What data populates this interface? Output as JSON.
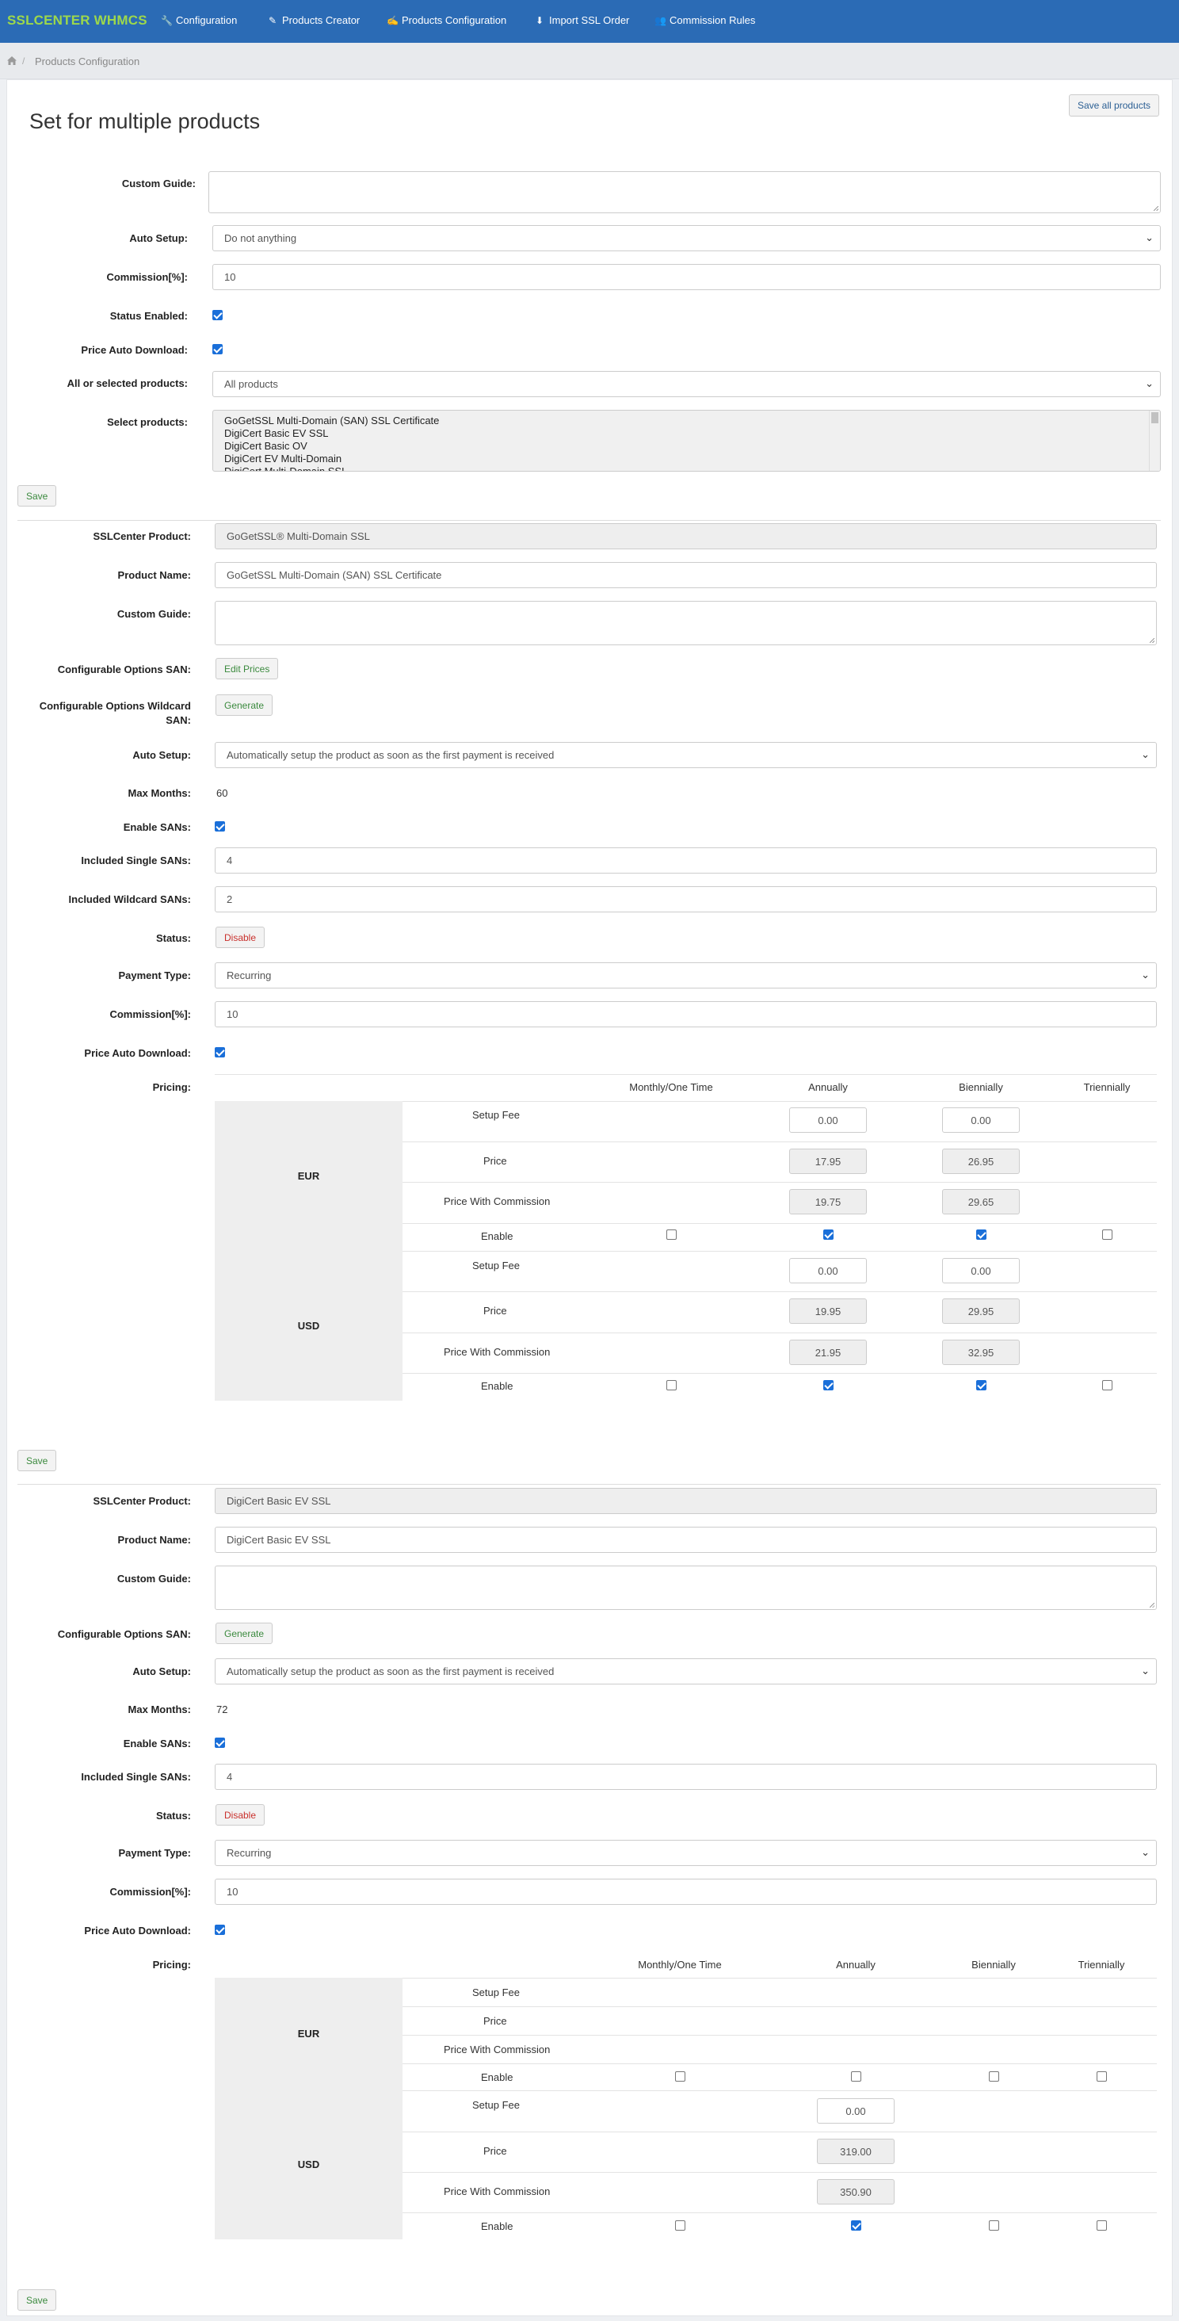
{
  "brand": "SSLCENTER WHMCS",
  "nav": [
    {
      "label": "Configuration",
      "icon": "wrench-icon"
    },
    {
      "label": "Products Creator",
      "icon": "magic-icon"
    },
    {
      "label": "Products Configuration",
      "icon": "edit-icon"
    },
    {
      "label": "Import SSL Order",
      "icon": "download-icon"
    },
    {
      "label": "Commission Rules",
      "icon": "users-icon"
    }
  ],
  "breadcrumb": {
    "current": "Products Configuration"
  },
  "multi": {
    "title": "Set for multiple products",
    "save_all": "Save all products",
    "labels": {
      "custom_guide": "Custom Guide:",
      "auto_setup": "Auto Setup:",
      "commission": "Commission[%]:",
      "status_enabled": "Status Enabled:",
      "price_auto": "Price Auto Download:",
      "all_or_selected": "All or selected products:",
      "select_products": "Select products:"
    },
    "auto_setup_value": "Do not anything",
    "commission_value": "10",
    "status_enabled": true,
    "price_auto": true,
    "all_or_selected_value": "All products",
    "products": [
      "GoGetSSL Multi-Domain (SAN) SSL Certificate",
      "DigiCert Basic EV SSL",
      "DigiCert Basic OV",
      "DigiCert EV Multi-Domain",
      "DigiCert Multi-Domain SSL"
    ],
    "save": "Save"
  },
  "labels": {
    "sslcenter_product": "SSLCenter Product:",
    "product_name": "Product Name:",
    "custom_guide": "Custom Guide:",
    "config_san": "Configurable Options SAN:",
    "config_wildcard_1": "Configurable Options Wildcard",
    "config_wildcard_2": "SAN:",
    "auto_setup": "Auto Setup:",
    "max_months": "Max Months:",
    "enable_sans": "Enable SANs:",
    "included_single": "Included Single SANs:",
    "included_wildcard": "Included Wildcard SANs:",
    "status": "Status:",
    "payment_type": "Payment Type:",
    "commission": "Commission[%]:",
    "price_auto": "Price Auto Download:",
    "pricing": "Pricing:"
  },
  "pricing_headers": [
    "Monthly/One Time",
    "Annually",
    "Biennially",
    "Triennially"
  ],
  "pricing_rows": [
    "Setup Fee",
    "Price",
    "Price With Commission",
    "Enable"
  ],
  "product1": {
    "sslcenter_product": "GoGetSSL® Multi-Domain SSL",
    "product_name": "GoGetSSL Multi-Domain (SAN) SSL Certificate",
    "config_san_button": "Edit Prices",
    "config_wildcard_button": "Generate",
    "auto_setup_value": "Automatically setup the product as soon as the first payment is received",
    "max_months": "60",
    "enable_sans": true,
    "included_single": "4",
    "included_wildcard": "2",
    "status_button": "Disable",
    "payment_type": "Recurring",
    "commission": "10",
    "price_auto": true,
    "eur": {
      "currency": "EUR",
      "setup_fee": [
        "0.00",
        "0.00"
      ],
      "price": [
        "17.95",
        "26.95"
      ],
      "price_with_commission": [
        "19.75",
        "29.65"
      ],
      "enable": [
        false,
        true,
        true,
        false
      ]
    },
    "usd": {
      "currency": "USD",
      "setup_fee": [
        "0.00",
        "0.00"
      ],
      "price": [
        "19.95",
        "29.95"
      ],
      "price_with_commission": [
        "21.95",
        "32.95"
      ],
      "enable": [
        false,
        true,
        true,
        false
      ]
    },
    "save": "Save"
  },
  "product2": {
    "sslcenter_product": "DigiCert Basic EV SSL",
    "product_name": "DigiCert Basic EV SSL",
    "config_san_button": "Generate",
    "auto_setup_value": "Automatically setup the product as soon as the first payment is received",
    "max_months": "72",
    "enable_sans": true,
    "included_single": "4",
    "status_button": "Disable",
    "payment_type": "Recurring",
    "commission": "10",
    "price_auto": true,
    "eur": {
      "currency": "EUR",
      "enable": [
        false,
        false,
        false,
        false
      ]
    },
    "usd": {
      "currency": "USD",
      "setup_fee": "0.00",
      "price": "319.00",
      "price_with_commission": "350.90",
      "enable": [
        false,
        true,
        false,
        false
      ]
    },
    "save": "Save"
  }
}
